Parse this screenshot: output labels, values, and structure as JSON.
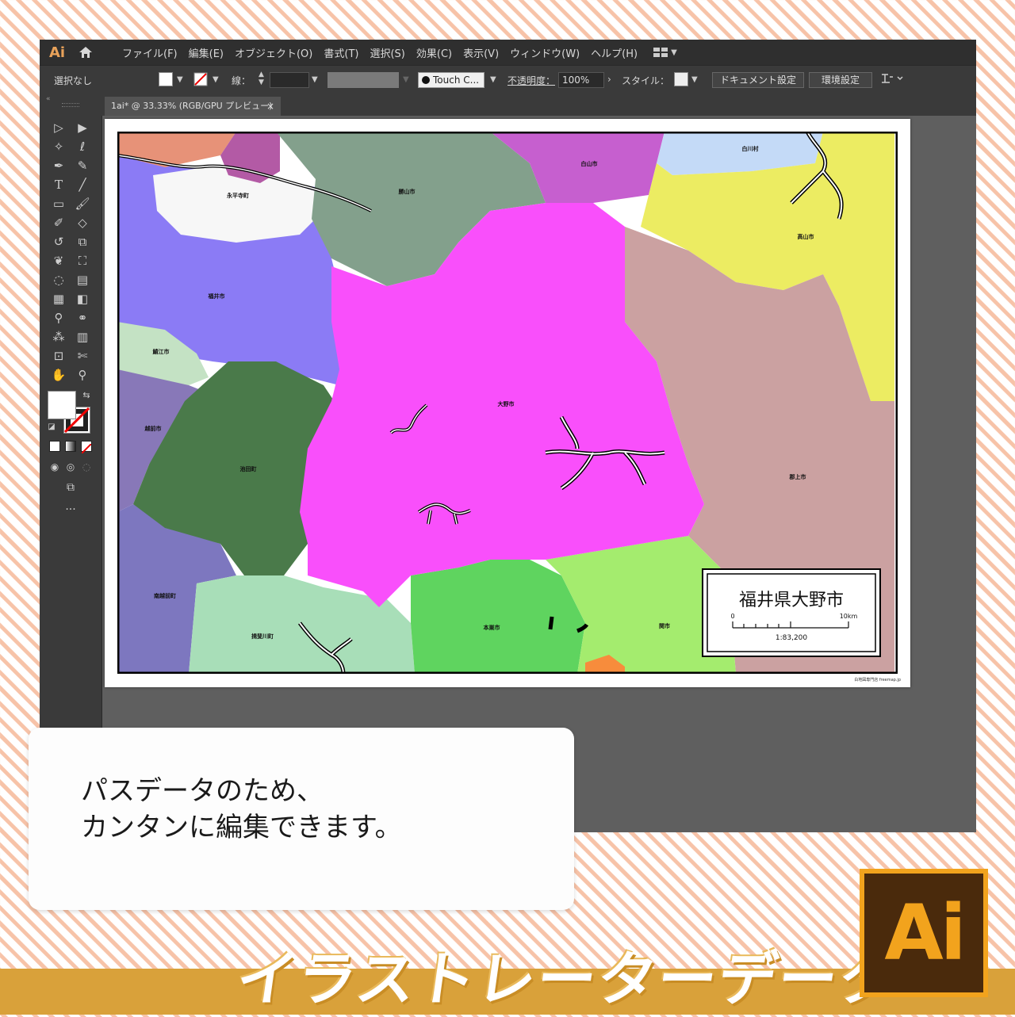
{
  "app": {
    "logo": "Ai",
    "menus": [
      "ファイル(F)",
      "編集(E)",
      "オブジェクト(O)",
      "書式(T)",
      "選択(S)",
      "効果(C)",
      "表示(V)",
      "ウィンドウ(W)",
      "ヘルプ(H)"
    ]
  },
  "control_bar": {
    "selection": "選択なし",
    "stroke_label": "線：",
    "brush": "Touch C...",
    "opacity_label": "不透明度：",
    "opacity_value": "100%",
    "style_label": "スタイル：",
    "document_settings": "ドキュメント設定",
    "preferences": "環境設定"
  },
  "document_tab": {
    "title": "1ai* @ 33.33% (RGB/GPU プレビュー)",
    "close": "×"
  },
  "map": {
    "municipalities": [
      "白川村",
      "白山市",
      "勝山市",
      "永平寺町",
      "高山市",
      "福井市",
      "鯖江市",
      "大野市",
      "越前市",
      "池田町",
      "郡上市",
      "南越前町",
      "揖斐川町",
      "本巣市",
      "関市"
    ],
    "legend": {
      "title": "福井県大野市",
      "scale_start": "0",
      "scale_end": "10km",
      "scale_ratio": "1:83,200"
    },
    "credit": "白地図専門店 freemap.jp"
  },
  "caption": {
    "line1": "パスデータのため、",
    "line2": "カンタンに編集できます。"
  },
  "banner": {
    "text": "イラストレーターデータ",
    "badge": "Ai"
  },
  "colors": {
    "ono": "#f94ffb",
    "orange_band": "#d9a13a",
    "badge_border": "#f2a31d",
    "badge_bg": "#4a2a0c"
  }
}
